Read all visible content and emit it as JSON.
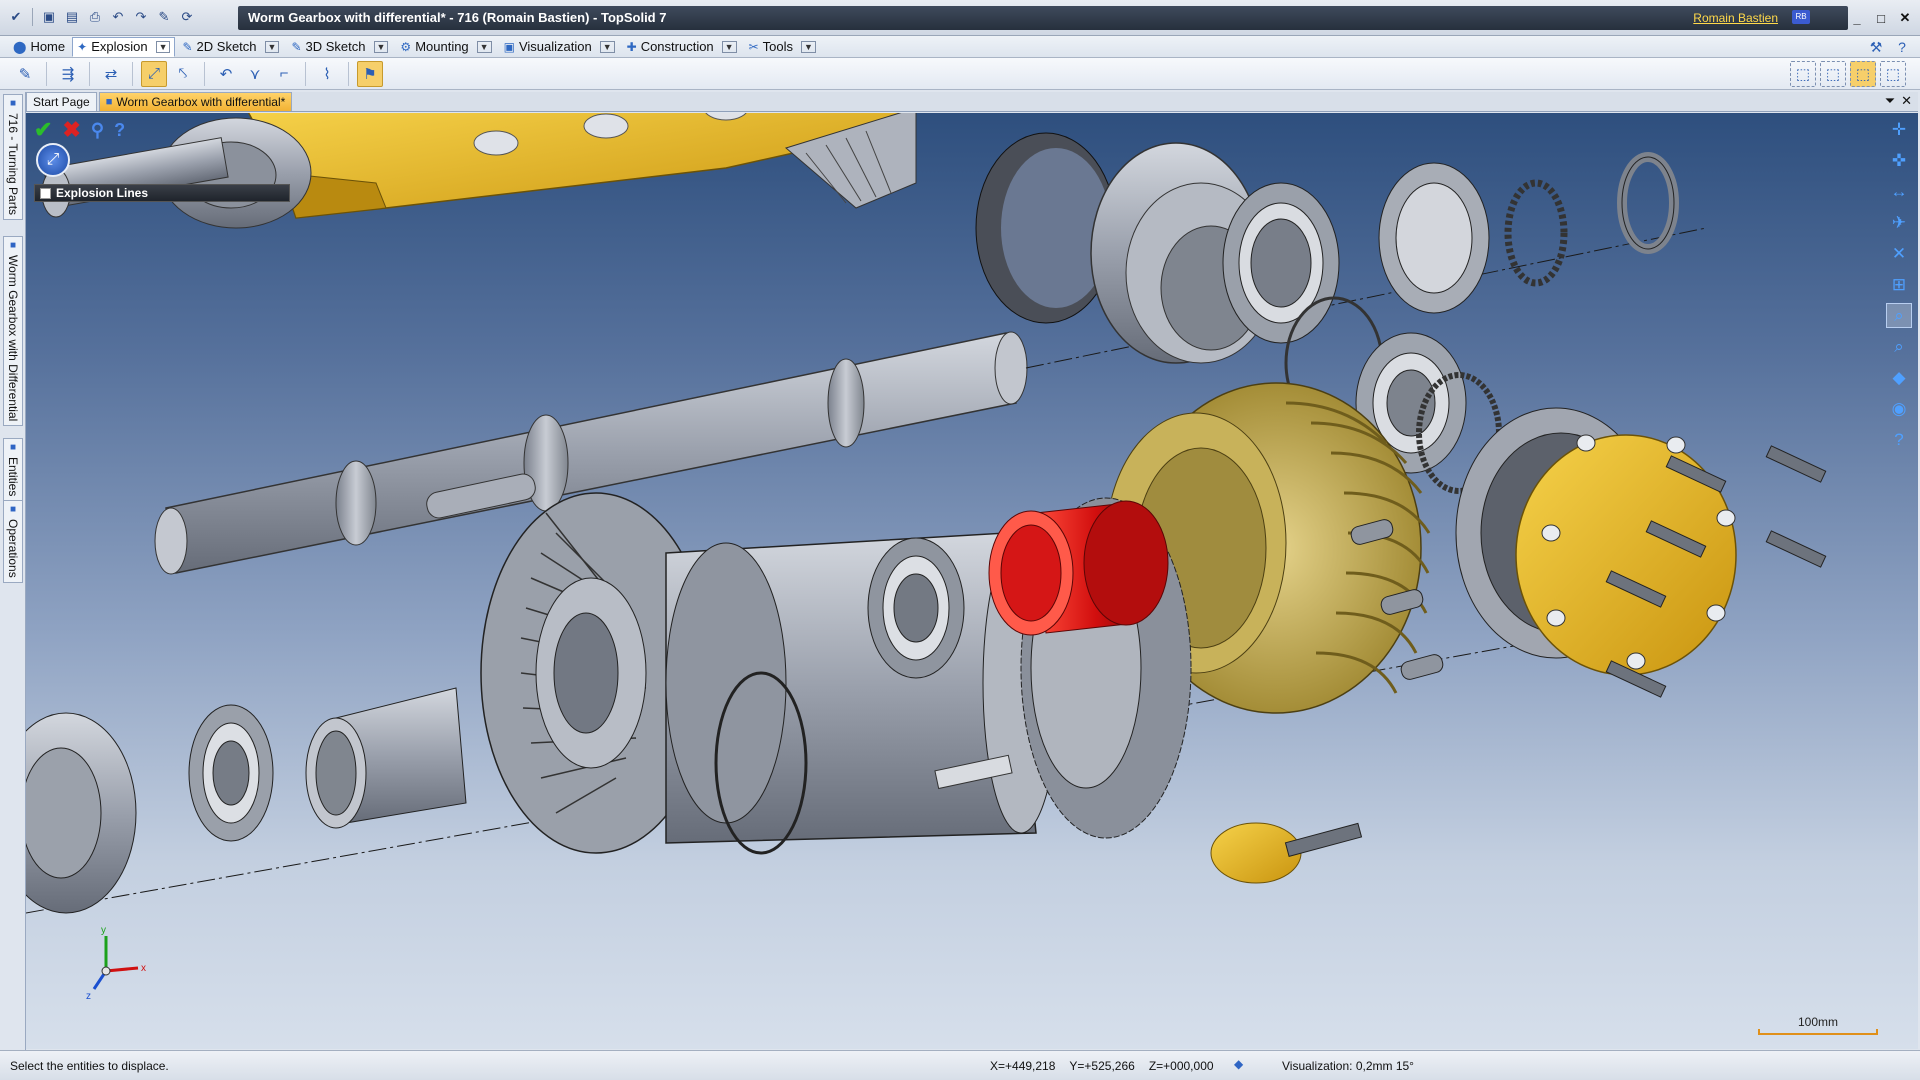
{
  "window": {
    "title": "Worm Gearbox with differential* - 716 (Romain Bastien) - TopSolid 7",
    "user": "Romain Bastien",
    "user_badge": "RB",
    "controls": [
      "_",
      "□",
      "✕"
    ]
  },
  "quick_access": {
    "icons": [
      "app-icon",
      "save-icon",
      "save-all-icon",
      "print-icon",
      "undo-icon",
      "redo-icon",
      "pen-icon",
      "refresh-icon"
    ]
  },
  "ribbon": {
    "tabs": [
      {
        "label": "Home",
        "icon": "⬤",
        "active": false,
        "has_dropdown": false
      },
      {
        "label": "Explosion",
        "icon": "✦",
        "active": true,
        "has_dropdown": true
      },
      {
        "label": "2D Sketch",
        "icon": "✎",
        "active": false,
        "has_dropdown": true
      },
      {
        "label": "3D Sketch",
        "icon": "✎",
        "active": false,
        "has_dropdown": true
      },
      {
        "label": "Mounting",
        "icon": "⚙",
        "active": false,
        "has_dropdown": true
      },
      {
        "label": "Visualization",
        "icon": "▣",
        "active": false,
        "has_dropdown": true
      },
      {
        "label": "Construction",
        "icon": "✚",
        "active": false,
        "has_dropdown": true
      },
      {
        "label": "Tools",
        "icon": "✂",
        "active": false,
        "has_dropdown": true
      }
    ]
  },
  "doc_tabs": [
    {
      "label": "Start Page",
      "active": false
    },
    {
      "label": "Worm Gearbox with differential*",
      "active": true
    }
  ],
  "side_tabs": [
    {
      "label": "716 - Turning Parts"
    },
    {
      "label": "Worm Gearbox with Differential"
    },
    {
      "label": "Entities"
    },
    {
      "label": "Operations"
    }
  ],
  "viewport": {
    "explosion_lines_label": "Explosion Lines",
    "explosion_lines_checked": false,
    "scale_label": "100mm",
    "axes": {
      "x": "x",
      "y": "y",
      "z": "z"
    }
  },
  "status": {
    "message": "Select the entities to displace.",
    "x": "X=+449,218",
    "y": "Y=+525,266",
    "z": "Z=+000,000",
    "visualization": "Visualization: 0,2mm 15°"
  },
  "colors": {
    "housing": "#e6b422",
    "highlight": "#e01010",
    "worm_wheel": "#c8b25a",
    "metal": "#9ea4b0",
    "viewport_top": "#2e4f7e",
    "viewport_bottom": "#d6dfeb"
  }
}
